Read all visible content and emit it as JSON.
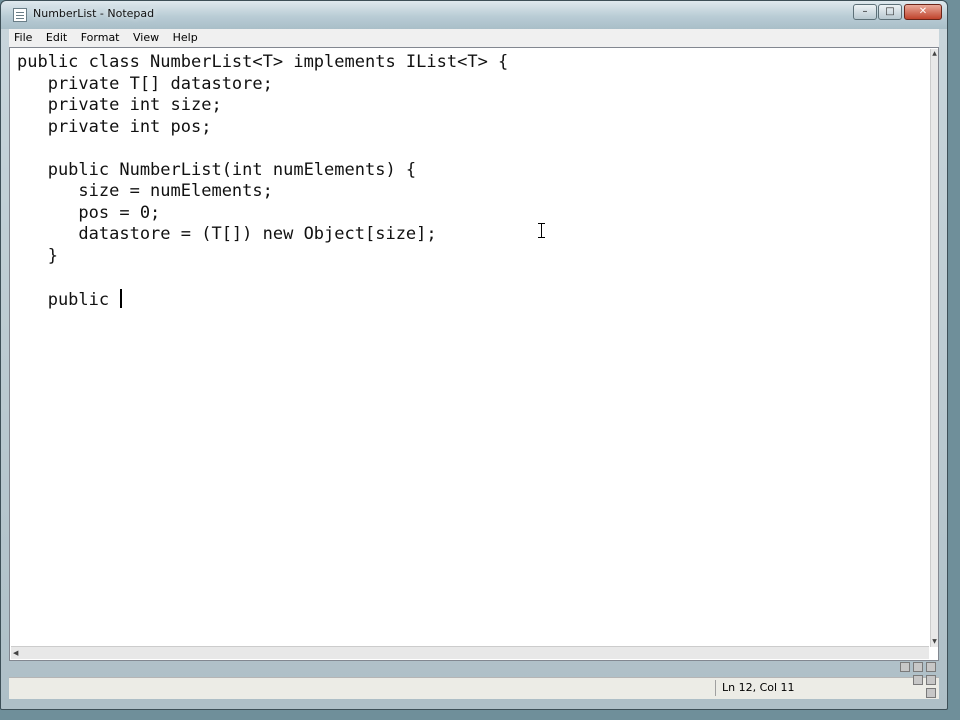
{
  "window": {
    "title": "NumberList - Notepad",
    "app_icon": "notepad-icon",
    "controls": {
      "minimize": "–",
      "maximize": "□",
      "close": "✕"
    }
  },
  "menubar": {
    "items": [
      {
        "label": "File"
      },
      {
        "label": "Edit"
      },
      {
        "label": "Format"
      },
      {
        "label": "View"
      },
      {
        "label": "Help"
      }
    ]
  },
  "editor": {
    "lines": [
      "public class NumberList<T> implements IList<T> {",
      "   private T[] datastore;",
      "   private int size;",
      "   private int pos;",
      "",
      "   public NumberList(int numElements) {",
      "      size = numElements;",
      "      pos = 0;",
      "      datastore = (T[]) new Object[size];",
      "   }",
      "",
      "   public "
    ]
  },
  "statusbar": {
    "position": "Ln 12, Col 11"
  },
  "colors": {
    "titlebar": "#b9ccd5",
    "close_button": "#c0432c",
    "editor_background": "#ffffff"
  }
}
